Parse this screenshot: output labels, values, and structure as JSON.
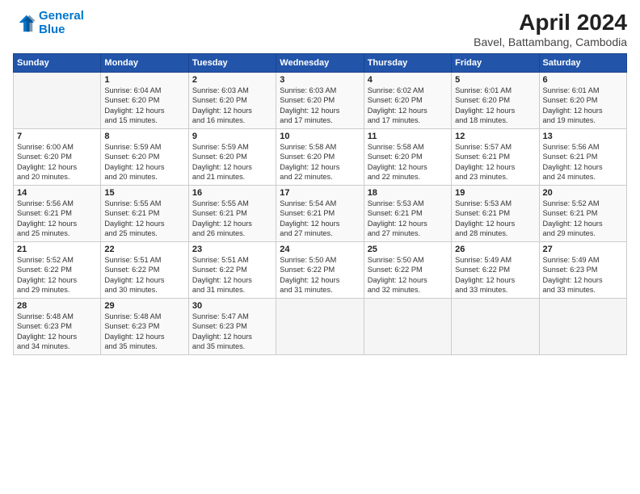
{
  "header": {
    "logo_line1": "General",
    "logo_line2": "Blue",
    "title": "April 2024",
    "subtitle": "Bavel, Battambang, Cambodia"
  },
  "weekdays": [
    "Sunday",
    "Monday",
    "Tuesday",
    "Wednesday",
    "Thursday",
    "Friday",
    "Saturday"
  ],
  "weeks": [
    [
      {
        "day": "",
        "info": ""
      },
      {
        "day": "1",
        "info": "Sunrise: 6:04 AM\nSunset: 6:20 PM\nDaylight: 12 hours\nand 15 minutes."
      },
      {
        "day": "2",
        "info": "Sunrise: 6:03 AM\nSunset: 6:20 PM\nDaylight: 12 hours\nand 16 minutes."
      },
      {
        "day": "3",
        "info": "Sunrise: 6:03 AM\nSunset: 6:20 PM\nDaylight: 12 hours\nand 17 minutes."
      },
      {
        "day": "4",
        "info": "Sunrise: 6:02 AM\nSunset: 6:20 PM\nDaylight: 12 hours\nand 17 minutes."
      },
      {
        "day": "5",
        "info": "Sunrise: 6:01 AM\nSunset: 6:20 PM\nDaylight: 12 hours\nand 18 minutes."
      },
      {
        "day": "6",
        "info": "Sunrise: 6:01 AM\nSunset: 6:20 PM\nDaylight: 12 hours\nand 19 minutes."
      }
    ],
    [
      {
        "day": "7",
        "info": "Sunrise: 6:00 AM\nSunset: 6:20 PM\nDaylight: 12 hours\nand 20 minutes."
      },
      {
        "day": "8",
        "info": "Sunrise: 5:59 AM\nSunset: 6:20 PM\nDaylight: 12 hours\nand 20 minutes."
      },
      {
        "day": "9",
        "info": "Sunrise: 5:59 AM\nSunset: 6:20 PM\nDaylight: 12 hours\nand 21 minutes."
      },
      {
        "day": "10",
        "info": "Sunrise: 5:58 AM\nSunset: 6:20 PM\nDaylight: 12 hours\nand 22 minutes."
      },
      {
        "day": "11",
        "info": "Sunrise: 5:58 AM\nSunset: 6:20 PM\nDaylight: 12 hours\nand 22 minutes."
      },
      {
        "day": "12",
        "info": "Sunrise: 5:57 AM\nSunset: 6:21 PM\nDaylight: 12 hours\nand 23 minutes."
      },
      {
        "day": "13",
        "info": "Sunrise: 5:56 AM\nSunset: 6:21 PM\nDaylight: 12 hours\nand 24 minutes."
      }
    ],
    [
      {
        "day": "14",
        "info": "Sunrise: 5:56 AM\nSunset: 6:21 PM\nDaylight: 12 hours\nand 25 minutes."
      },
      {
        "day": "15",
        "info": "Sunrise: 5:55 AM\nSunset: 6:21 PM\nDaylight: 12 hours\nand 25 minutes."
      },
      {
        "day": "16",
        "info": "Sunrise: 5:55 AM\nSunset: 6:21 PM\nDaylight: 12 hours\nand 26 minutes."
      },
      {
        "day": "17",
        "info": "Sunrise: 5:54 AM\nSunset: 6:21 PM\nDaylight: 12 hours\nand 27 minutes."
      },
      {
        "day": "18",
        "info": "Sunrise: 5:53 AM\nSunset: 6:21 PM\nDaylight: 12 hours\nand 27 minutes."
      },
      {
        "day": "19",
        "info": "Sunrise: 5:53 AM\nSunset: 6:21 PM\nDaylight: 12 hours\nand 28 minutes."
      },
      {
        "day": "20",
        "info": "Sunrise: 5:52 AM\nSunset: 6:21 PM\nDaylight: 12 hours\nand 29 minutes."
      }
    ],
    [
      {
        "day": "21",
        "info": "Sunrise: 5:52 AM\nSunset: 6:22 PM\nDaylight: 12 hours\nand 29 minutes."
      },
      {
        "day": "22",
        "info": "Sunrise: 5:51 AM\nSunset: 6:22 PM\nDaylight: 12 hours\nand 30 minutes."
      },
      {
        "day": "23",
        "info": "Sunrise: 5:51 AM\nSunset: 6:22 PM\nDaylight: 12 hours\nand 31 minutes."
      },
      {
        "day": "24",
        "info": "Sunrise: 5:50 AM\nSunset: 6:22 PM\nDaylight: 12 hours\nand 31 minutes."
      },
      {
        "day": "25",
        "info": "Sunrise: 5:50 AM\nSunset: 6:22 PM\nDaylight: 12 hours\nand 32 minutes."
      },
      {
        "day": "26",
        "info": "Sunrise: 5:49 AM\nSunset: 6:22 PM\nDaylight: 12 hours\nand 33 minutes."
      },
      {
        "day": "27",
        "info": "Sunrise: 5:49 AM\nSunset: 6:23 PM\nDaylight: 12 hours\nand 33 minutes."
      }
    ],
    [
      {
        "day": "28",
        "info": "Sunrise: 5:48 AM\nSunset: 6:23 PM\nDaylight: 12 hours\nand 34 minutes."
      },
      {
        "day": "29",
        "info": "Sunrise: 5:48 AM\nSunset: 6:23 PM\nDaylight: 12 hours\nand 35 minutes."
      },
      {
        "day": "30",
        "info": "Sunrise: 5:47 AM\nSunset: 6:23 PM\nDaylight: 12 hours\nand 35 minutes."
      },
      {
        "day": "",
        "info": ""
      },
      {
        "day": "",
        "info": ""
      },
      {
        "day": "",
        "info": ""
      },
      {
        "day": "",
        "info": ""
      }
    ]
  ]
}
